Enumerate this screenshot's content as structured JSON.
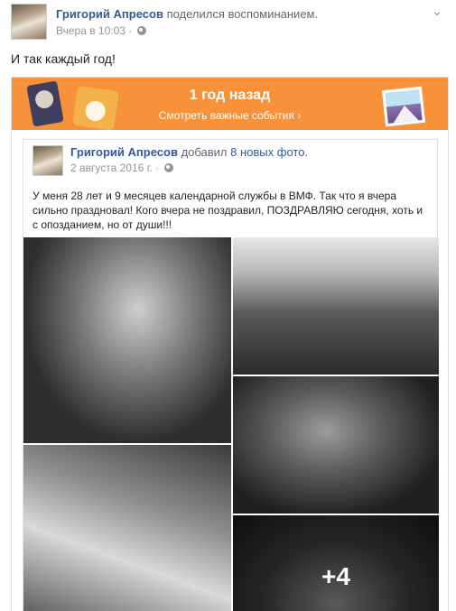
{
  "post": {
    "author": "Григорий Апресов",
    "action": "поделился воспоминанием.",
    "time": "Вчера в 10:03",
    "time_sep": "·",
    "text": "И так каждый год!"
  },
  "memory": {
    "title": "1 год назад",
    "link": "Смотреть важные события ›",
    "inner_post": {
      "author": "Григорий Апресов",
      "action_prefix": "добавил",
      "action_link": "8 новых фото",
      "action_suffix": ".",
      "date": "2 августа 2016 г.",
      "date_sep": "·",
      "text": "У меня 28 лет и 9 месяцев календарной службы в ВМФ. Так что я вчера сильно праздновал! Кого вчера не поздравил, ПОЗДРАВЛЯЮ сегодня, хоть и с опозданием, но от души!!!",
      "more_photos": "+4"
    }
  },
  "colors": {
    "banner": "#f7923a",
    "link": "#365899",
    "meta": "#90949c"
  },
  "icons": [
    "globe-icon",
    "chevron-down-icon"
  ]
}
